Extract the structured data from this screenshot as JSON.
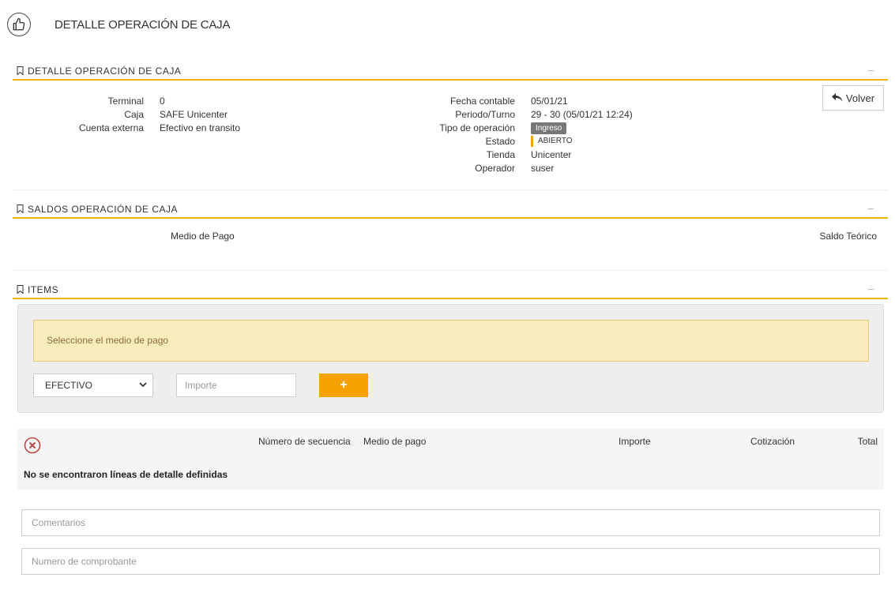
{
  "page": {
    "title": "DETALLE OPERACIÓN DE CAJA",
    "header_icon": "thumbs-up-icon"
  },
  "sections": {
    "detalle": {
      "title": "DETALLE OPERACIÓN DE CAJA",
      "collapse": "–"
    },
    "saldos": {
      "title": "SALDOS OPERACIÓN DE CAJA",
      "collapse": "–"
    },
    "items": {
      "title": "ITEMS",
      "collapse": "–"
    }
  },
  "detalle": {
    "left": [
      {
        "label": "Terminal",
        "value": "0"
      },
      {
        "label": "Caja",
        "value": "SAFE Unicenter"
      },
      {
        "label": "Cuenta externa",
        "value": "Efectivo en transito"
      }
    ],
    "right": {
      "fecha_contable": {
        "label": "Fecha contable",
        "value": "05/01/21"
      },
      "periodo_turno": {
        "label": "Periodo/Turno",
        "value": "29 - 30 (05/01/21 12:24)"
      },
      "tipo_operacion": {
        "label": "Tipo de operación",
        "value": "Ingreso"
      },
      "estado": {
        "label": "Estado",
        "value": "ABIERTO",
        "color": "#f5a300"
      },
      "tienda": {
        "label": "Tienda",
        "value": "Unicenter"
      },
      "operador": {
        "label": "Operador",
        "value": "suser"
      }
    },
    "volver_button": "Volver"
  },
  "saldos": {
    "columns": [
      "Medio de Pago",
      "Saldo Teórico"
    ]
  },
  "items": {
    "alert": "Seleccione el medio de pago",
    "medio_select_value": "EFECTIVO",
    "importe_placeholder": "Importe",
    "add_button": "+"
  },
  "detail_table": {
    "columns": [
      "Número de secuencia",
      "Medio de pago",
      "Importe",
      "Cotización",
      "Total"
    ],
    "empty_message": "No se encontraron líneas de detalle definidas"
  },
  "fields": {
    "comentarios_placeholder": "Comentarios",
    "comprobante_placeholder": "Numero de comprobante"
  },
  "colors": {
    "accent": "#f5b300",
    "add_button": "#f5a300",
    "alert_bg": "#f8ecbd",
    "badge_bg": "#777777",
    "error": "#b94a48"
  }
}
